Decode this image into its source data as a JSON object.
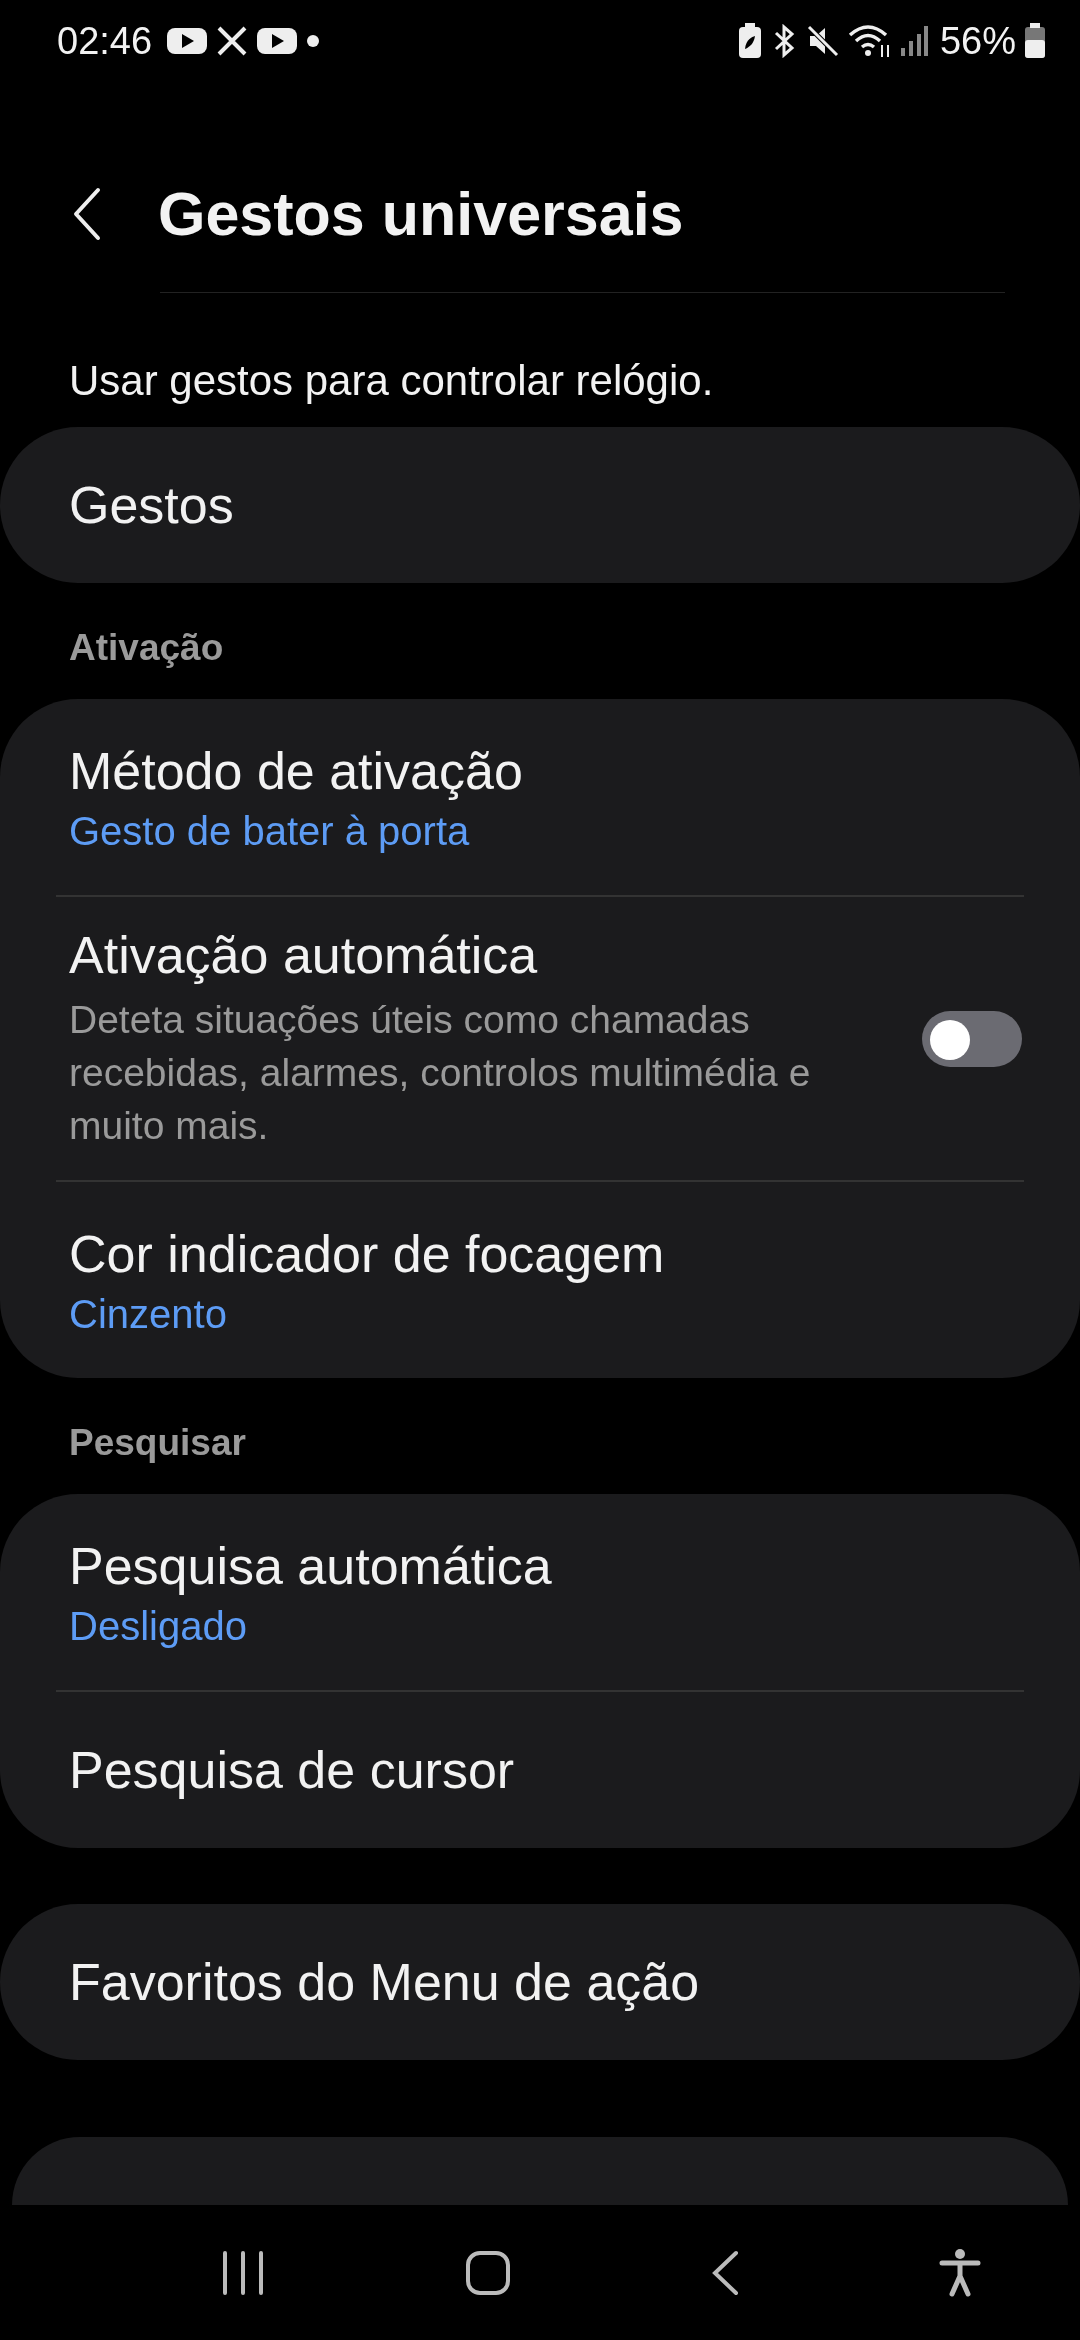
{
  "status_bar": {
    "time": "02:46",
    "battery": "56%"
  },
  "header": {
    "title": "Gestos universais"
  },
  "description": "Usar gestos para controlar relógio.",
  "groups": [
    {
      "items": [
        {
          "kind": "link",
          "title": "Gestos"
        }
      ]
    },
    {
      "heading": "Ativação",
      "items": [
        {
          "kind": "link",
          "title": "Método de ativação",
          "value": "Gesto de bater à porta"
        },
        {
          "kind": "toggle",
          "title": "Ativação automática",
          "summary": "Deteta situações úteis como chamadas recebidas, alarmes, controlos multimédia e muito mais.",
          "on": false
        },
        {
          "kind": "link",
          "title": "Cor indicador de focagem",
          "value": "Cinzento"
        }
      ]
    },
    {
      "heading": "Pesquisar",
      "items": [
        {
          "kind": "link",
          "title": "Pesquisa automática",
          "value": "Desligado"
        },
        {
          "kind": "link",
          "title": "Pesquisa de cursor"
        }
      ]
    },
    {
      "items": [
        {
          "kind": "link",
          "title": "Favoritos do Menu de ação"
        }
      ]
    }
  ]
}
